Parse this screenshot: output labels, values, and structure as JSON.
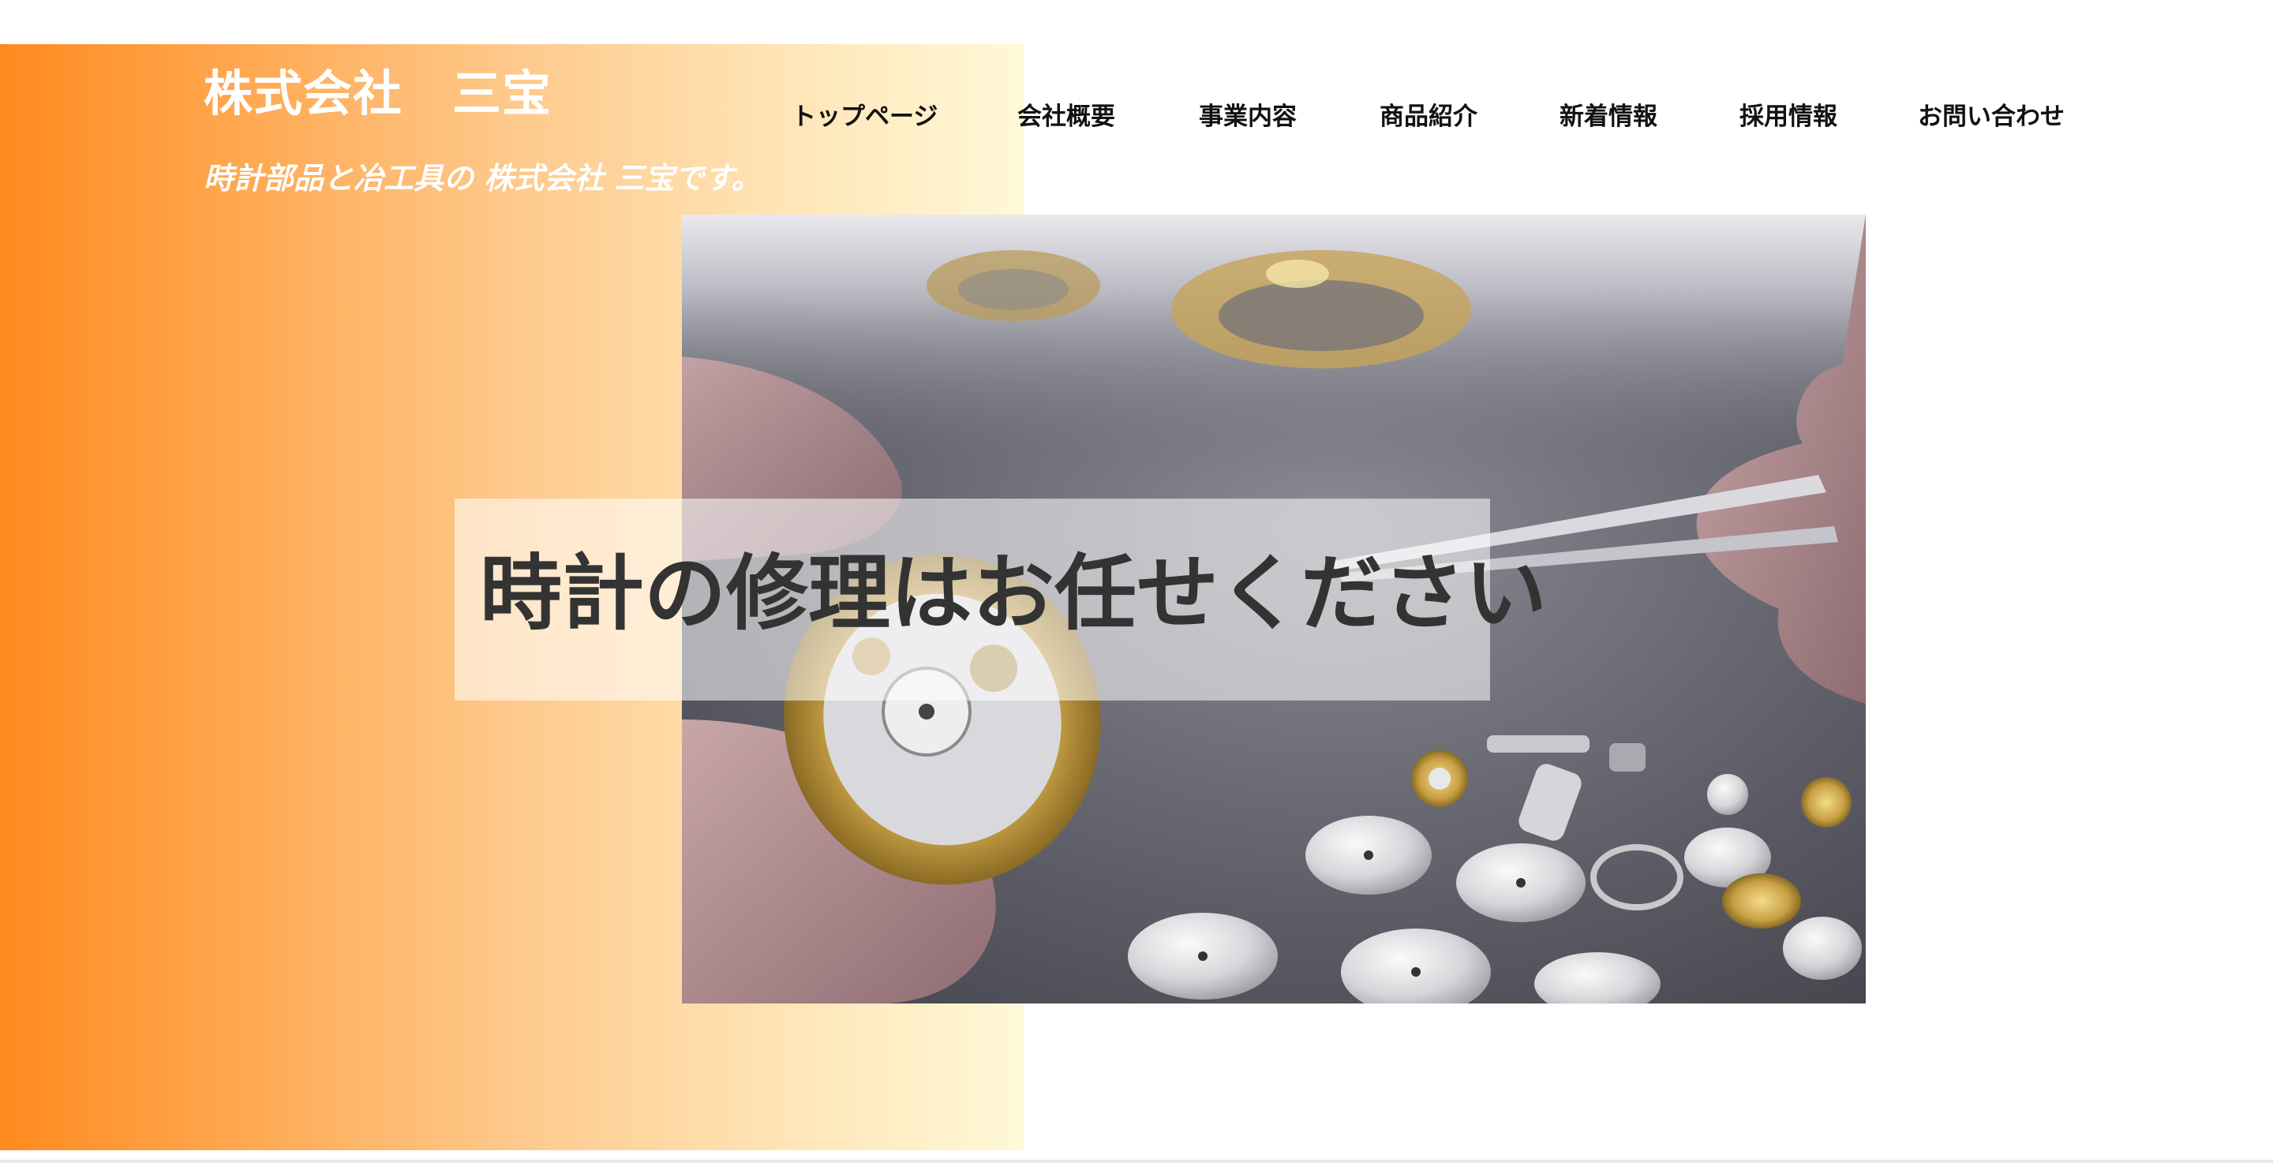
{
  "header": {
    "company_name": "株式会社　三宝",
    "tagline": "時計部品と冶工具の 株式会社 三宝です。"
  },
  "nav": {
    "items": [
      {
        "label": "トップページ"
      },
      {
        "label": "会社概要"
      },
      {
        "label": "事業内容"
      },
      {
        "label": "商品紹介"
      },
      {
        "label": "新着情報"
      },
      {
        "label": "採用情報"
      },
      {
        "label": "お問い合わせ"
      }
    ]
  },
  "hero": {
    "caption": "時計の修理はお任せください"
  },
  "colors": {
    "gradient_start": "#ff8a1f",
    "gradient_end": "#fff8d8",
    "header_text": "#ffffff",
    "nav_text": "#111111",
    "caption_text": "#333333"
  }
}
